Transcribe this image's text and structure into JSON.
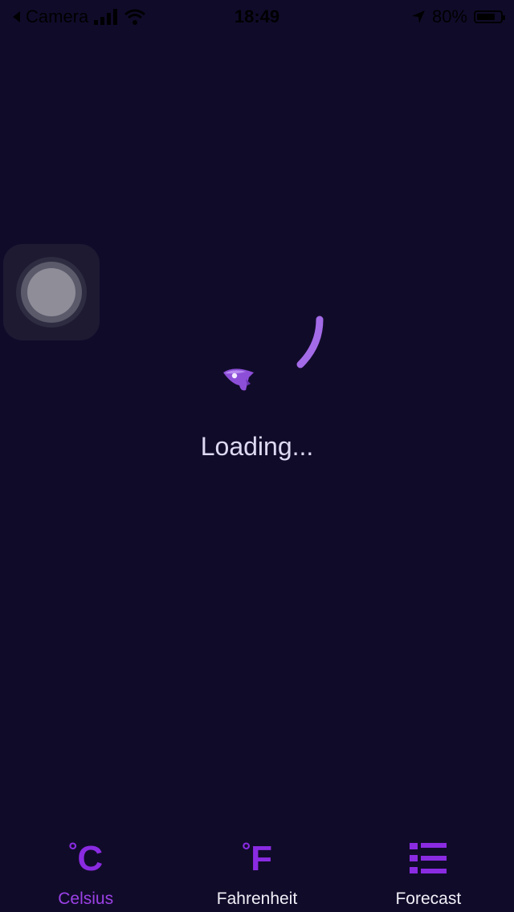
{
  "status_bar": {
    "back_app": "Camera",
    "time": "18:49",
    "battery_percent": "80%",
    "battery_level": 0.8
  },
  "loader": {
    "text": "Loading..."
  },
  "tabs": [
    {
      "label": "Celsius",
      "icon": "celsius-icon",
      "active": true
    },
    {
      "label": "Fahrenheit",
      "icon": "fahrenheit-icon",
      "active": false
    },
    {
      "label": "Forecast",
      "icon": "list-icon",
      "active": false
    }
  ],
  "colors": {
    "background": "#110b2a",
    "accent": "#8a2be2",
    "loader": "#a36be8",
    "text": "#ded9f2"
  }
}
